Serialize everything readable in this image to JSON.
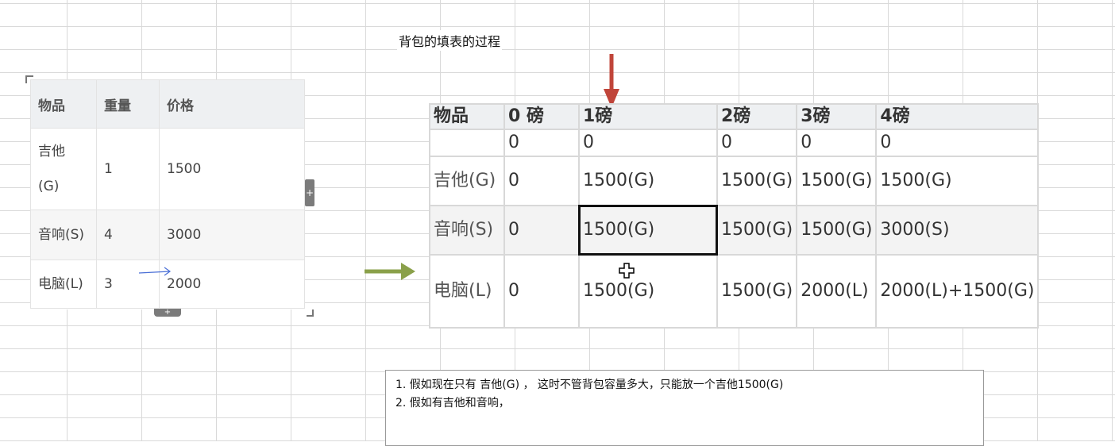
{
  "title": "背包的填表的过程",
  "left_table": {
    "headers": [
      "物品",
      "重量",
      "价格"
    ],
    "rows": [
      {
        "item": "吉他(G)",
        "weight": "1",
        "price": "1500"
      },
      {
        "item": "音响(S)",
        "weight": "4",
        "price": "3000"
      },
      {
        "item": "电脑(L)",
        "weight": "3",
        "price": "2000"
      }
    ],
    "item_g_line1": "吉他",
    "item_g_line2": "(G)"
  },
  "right_table": {
    "headers": [
      "物品",
      "0 磅",
      "1磅",
      "2磅",
      "3磅",
      "4磅"
    ],
    "zero_row": [
      "",
      "0",
      "0",
      "0",
      "0",
      "0"
    ],
    "rows": [
      {
        "label": "吉他(G)",
        "cells": [
          "0",
          "1500(G)",
          "1500(G)",
          "1500(G)",
          "1500(G)"
        ]
      },
      {
        "label": "音响(S)",
        "cells": [
          "0",
          "1500(G)",
          "1500(G)",
          "1500(G)",
          "3000(S)"
        ]
      },
      {
        "label": "电脑(L)",
        "cells": [
          "0",
          "1500(G)",
          "1500(G)",
          "2000(L)",
          "2000(L)+1500(G)"
        ]
      }
    ]
  },
  "notes": {
    "line1": "1. 假如现在只有  吉他(G) ， 这时不管背包容量多大，只能放一个吉他1500(G)",
    "line2": "2. 假如有吉他和音响，"
  },
  "handles": {
    "right": "+",
    "bottom": "+"
  },
  "colors": {
    "red_arrow": "#c0453a",
    "green_arrow": "#8aa04a",
    "blue_arrow": "#4a6fd6",
    "selection": "#111111"
  }
}
